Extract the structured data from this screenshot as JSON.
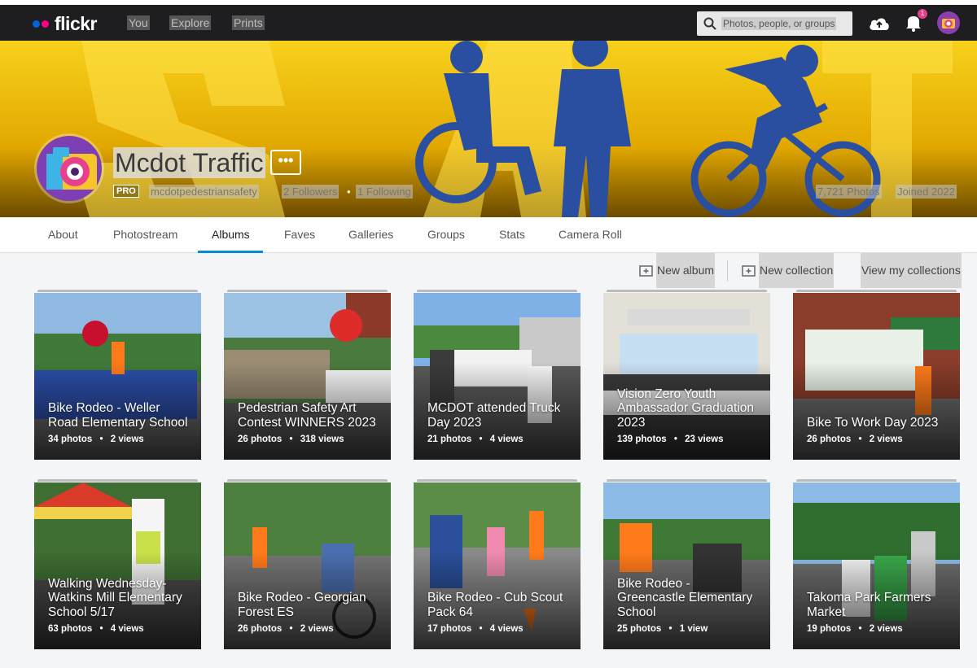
{
  "nav": {
    "brand": "flickr",
    "links": [
      "You",
      "Explore",
      "Prints"
    ],
    "search_placeholder": "Photos, people, or groups",
    "notification_count": "1"
  },
  "profile": {
    "name": "Mcdot Traffic",
    "more_label": "•••",
    "pro_badge": "PRO",
    "username": "mcdotpedestriansafety",
    "followers": "2 Followers",
    "separator": "•",
    "following": "1 Following",
    "photos": "7,721 Photos",
    "joined": "Joined 2022"
  },
  "tabs": [
    "About",
    "Photostream",
    "Albums",
    "Faves",
    "Galleries",
    "Groups",
    "Stats",
    "Camera Roll"
  ],
  "active_tab": "Albums",
  "actions": {
    "new_album": "New album",
    "new_collection": "New collection",
    "view_collections": "View my collections"
  },
  "albums": [
    {
      "title": "Bike Rodeo - Weller Road Elementary School",
      "photos": "34 photos",
      "views": "2 views"
    },
    {
      "title": "Pedestrian Safety Art Contest WINNERS 2023",
      "photos": "26 photos",
      "views": "318 views"
    },
    {
      "title": "MCDOT attended Truck Day 2023",
      "photos": "21 photos",
      "views": "4 views"
    },
    {
      "title": "Vision Zero Youth Ambassador Graduation 2023",
      "photos": "139 photos",
      "views": "23 views"
    },
    {
      "title": "Bike To Work Day 2023",
      "photos": "26 photos",
      "views": "2 views"
    },
    {
      "title": "Walking Wednesday-Watkins Mill Elementary School 5/17",
      "photos": "63 photos",
      "views": "4 views"
    },
    {
      "title": "Bike Rodeo - Georgian Forest ES",
      "photos": "26 photos",
      "views": "2 views"
    },
    {
      "title": "Bike Rodeo - Cub Scout Pack 64",
      "photos": "17 photos",
      "views": "4 views"
    },
    {
      "title": "Bike Rodeo - Greencastle Elementary School",
      "photos": "25 photos",
      "views": "1 view"
    },
    {
      "title": "Takoma Park Farmers Market",
      "photos": "19 photos",
      "views": "2 views"
    }
  ],
  "count_separator": "•",
  "colors": {
    "accent": "#008ecf",
    "flickr_blue": "#0063dc",
    "flickr_pink": "#ff0084",
    "cover_yellow": "#f0b400",
    "cover_blue": "#2a4fa0"
  }
}
